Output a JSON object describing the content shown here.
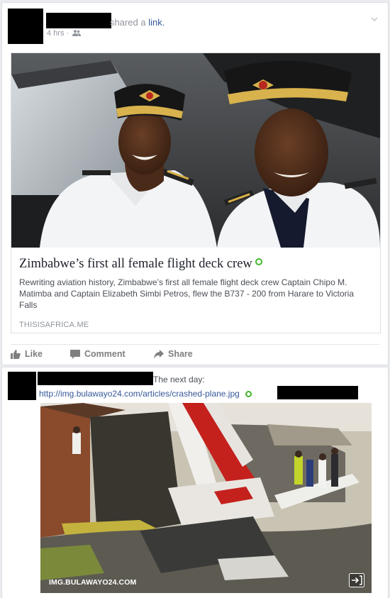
{
  "post1": {
    "shared_text": "shared a",
    "shared_link": "link.",
    "time": "4 hrs ·",
    "audience_icon": "friends-icon",
    "preview": {
      "title": "Zimbabwe’s first all female flight deck crew",
      "description": "Rewriting aviation history, Zimbabwe’s first all female flight deck crew Captain Chipo M. Matimba and Captain Elizabeth Simbi Petros, flew the B737 - 200 from Harare to Victoria Falls",
      "domain": "THISISAFRICA.ME"
    },
    "actions": {
      "like": "Like",
      "comment": "Comment",
      "share": "Share"
    }
  },
  "post2": {
    "text": "The next day:",
    "link": "http://img.bulawayo24.com/articles/crashed-plane.jpg",
    "image_caption": "IMG.BULAWAYO24.COM"
  },
  "colors": {
    "link": "#365899",
    "secondary": "#90949c",
    "verified_dot": "#42b72a",
    "background": "#e9ebee"
  }
}
